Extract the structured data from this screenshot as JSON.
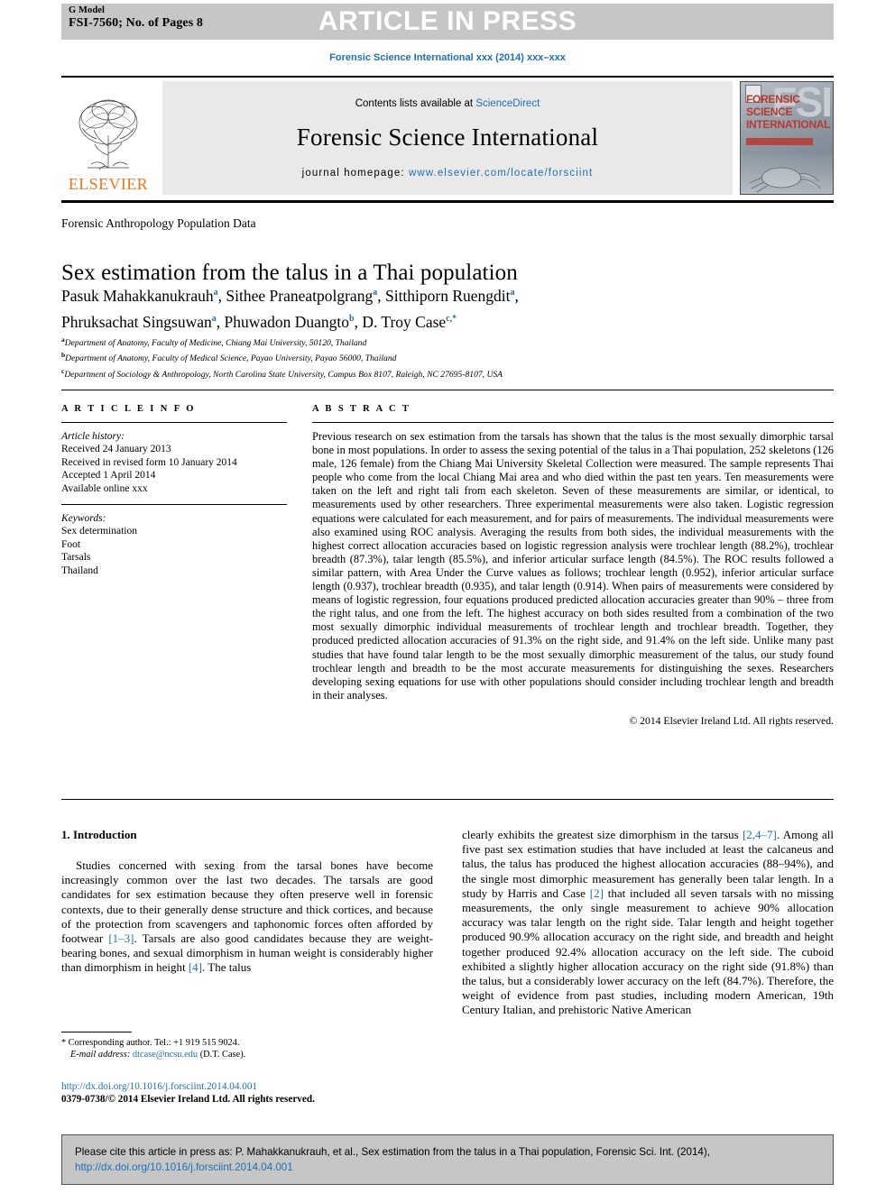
{
  "header": {
    "g_model_label": "G Model",
    "manuscript_id": "FSI-7560; No. of Pages 8",
    "press_banner": "ARTICLE IN PRESS",
    "running_head": "Forensic Science International xxx (2014) xxx–xxx"
  },
  "masthead": {
    "publisher_name": "ELSEVIER",
    "contents_prefix": "Contents lists available at ",
    "contents_link": "ScienceDirect",
    "journal_title": "Forensic Science International",
    "homepage_prefix": "journal homepage: ",
    "homepage_url": "www.elsevier.com/locate/forsciint",
    "cover_acronym": "FSI",
    "cover_word_1": "FORENSIC",
    "cover_word_2": "SCIENCE",
    "cover_word_3": "INTERNATIONAL"
  },
  "article": {
    "section_label": "Forensic Anthropology Population Data",
    "title": "Sex estimation from the talus in a Thai population",
    "authors_line_1_parts": [
      {
        "name": "Pasuk Mahakkanukrauh",
        "sup": "a",
        "sep": ", "
      },
      {
        "name": "Sithee Praneatpolgrang",
        "sup": "a",
        "sep": ", "
      },
      {
        "name": "Sitthiporn Ruengdit",
        "sup": "a",
        "sep": ","
      }
    ],
    "authors_line_2_parts": [
      {
        "name": "Phruksachat Singsuwan",
        "sup": "a",
        "sep": ", "
      },
      {
        "name": "Phuwadon Duangto",
        "sup": "b",
        "sep": ", "
      },
      {
        "name": "D. Troy Case",
        "sup": "c,*",
        "sep": ""
      }
    ],
    "affiliations": [
      {
        "marker": "a",
        "text": "Department of Anatomy, Faculty of Medicine, Chiang Mai University, 50120, Thailand"
      },
      {
        "marker": "b",
        "text": "Department of Anatomy, Faculty of Medical Science, Payao University, Payao 56000, Thailand"
      },
      {
        "marker": "c",
        "text": "Department of Sociology & Anthropology, North Carolina State University, Campus Box 8107, Raleigh, NC 27695-8107, USA"
      }
    ]
  },
  "article_info": {
    "heading": "A R T I C L E  I N F O",
    "history_label": "Article history:",
    "history": [
      "Received 24 January 2013",
      "Received in revised form 10 January 2014",
      "Accepted 1 April 2014",
      "Available online xxx"
    ],
    "keywords_label": "Keywords:",
    "keywords": [
      "Sex determination",
      "Foot",
      "Tarsals",
      "Thailand"
    ]
  },
  "abstract": {
    "heading": "A B S T R A C T",
    "text": "Previous research on sex estimation from the tarsals has shown that the talus is the most sexually dimorphic tarsal bone in most populations. In order to assess the sexing potential of the talus in a Thai population, 252 skeletons (126 male, 126 female) from the Chiang Mai University Skeletal Collection were measured. The sample represents Thai people who come from the local Chiang Mai area and who died within the past ten years. Ten measurements were taken on the left and right tali from each skeleton. Seven of these measurements are similar, or identical, to measurements used by other researchers. Three experimental measurements were also taken. Logistic regression equations were calculated for each measurement, and for pairs of measurements. The individual measurements were also examined using ROC analysis. Averaging the results from both sides, the individual measurements with the highest correct allocation accuracies based on logistic regression analysis were trochlear length (88.2%), trochlear breadth (87.3%), talar length (85.5%), and inferior articular surface length (84.5%). The ROC results followed a similar pattern, with Area Under the Curve values as follows; trochlear length (0.952), inferior articular surface length (0.937), trochlear breadth (0.935), and talar length (0.914). When pairs of measurements were considered by means of logistic regression, four equations produced predicted allocation accuracies greater than 90% – three from the right talus, and one from the left. The highest accuracy on both sides resulted from a combination of the two most sexually dimorphic individual measurements of trochlear length and trochlear breadth. Together, they produced predicted allocation accuracies of 91.3% on the right side, and 91.4% on the left side. Unlike many past studies that have found talar length to be the most sexually dimorphic measurement of the talus, our study found trochlear length and breadth to be the most accurate measurements for distinguishing the sexes. Researchers developing sexing equations for use with other populations should consider including trochlear length and breadth in their analyses.",
    "copyright": "© 2014 Elsevier Ireland Ltd. All rights reserved."
  },
  "body": {
    "intro_heading": "1. Introduction",
    "left_paragraph_segments": [
      {
        "type": "text",
        "value": "Studies concerned with sexing from the tarsal bones have become increasingly common over the last two decades. The tarsals are good candidates for sex estimation because they often preserve well in forensic contexts, due to their generally dense structure and thick cortices, and because of the protection from scavengers and taphonomic forces often afforded by footwear "
      },
      {
        "type": "ref",
        "value": "[1–3]"
      },
      {
        "type": "text",
        "value": ". Tarsals are also good candidates because they are weight-bearing bones, and sexual dimorphism in human weight is considerably higher than dimorphism in height "
      },
      {
        "type": "ref",
        "value": "[4]"
      },
      {
        "type": "text",
        "value": ". The talus"
      }
    ],
    "right_paragraph_segments": [
      {
        "type": "text",
        "value": "clearly exhibits the greatest size dimorphism in the tarsus "
      },
      {
        "type": "ref",
        "value": "[2,4–7]"
      },
      {
        "type": "text",
        "value": ". Among all five past sex estimation studies that have included at least the calcaneus and talus, the talus has produced the highest allocation accuracies (88–94%), and the single most dimorphic measurement has generally been talar length. In a study by Harris and Case "
      },
      {
        "type": "ref",
        "value": "[2]"
      },
      {
        "type": "text",
        "value": " that included all seven tarsals with no missing measurements, the only single measurement to achieve 90% allocation accuracy was talar length on the right side. Talar length and height together produced 90.9% allocation accuracy on the right side, and breadth and height together produced 92.4% allocation accuracy on the left side. The cuboid exhibited a slightly higher allocation accuracy on the right side (91.8%) than the talus, but a considerably lower accuracy on the left (84.7%). Therefore, the weight of evidence from past studies, including modern American, 19th Century Italian, and prehistoric Native American"
      }
    ]
  },
  "footnote": {
    "marker": "*",
    "corresponding": "Corresponding author. Tel.: +1 919 515 9024.",
    "email_label": "E-mail address:",
    "email": "dtcase@ncsu.edu",
    "email_owner": "(D.T. Case)."
  },
  "doi_block": {
    "doi_url": "http://dx.doi.org/10.1016/j.forsciint.2014.04.001",
    "issn_line": "0379-0738/© 2014 Elsevier Ireland Ltd. All rights reserved."
  },
  "citation_footer": {
    "line1": "Please cite this article in press as: P. Mahakkanukrauh, et al., Sex estimation from the talus in a Thai population, Forensic Sci. Int. (2014),",
    "line2": "http://dx.doi.org/10.1016/j.forsciint.2014.04.001"
  },
  "colors": {
    "link_blue": "#1f6fb2",
    "band_grey": "#c6c6c6",
    "elsevier_orange": "#e87722",
    "contents_grey": "#e9e9e9"
  }
}
